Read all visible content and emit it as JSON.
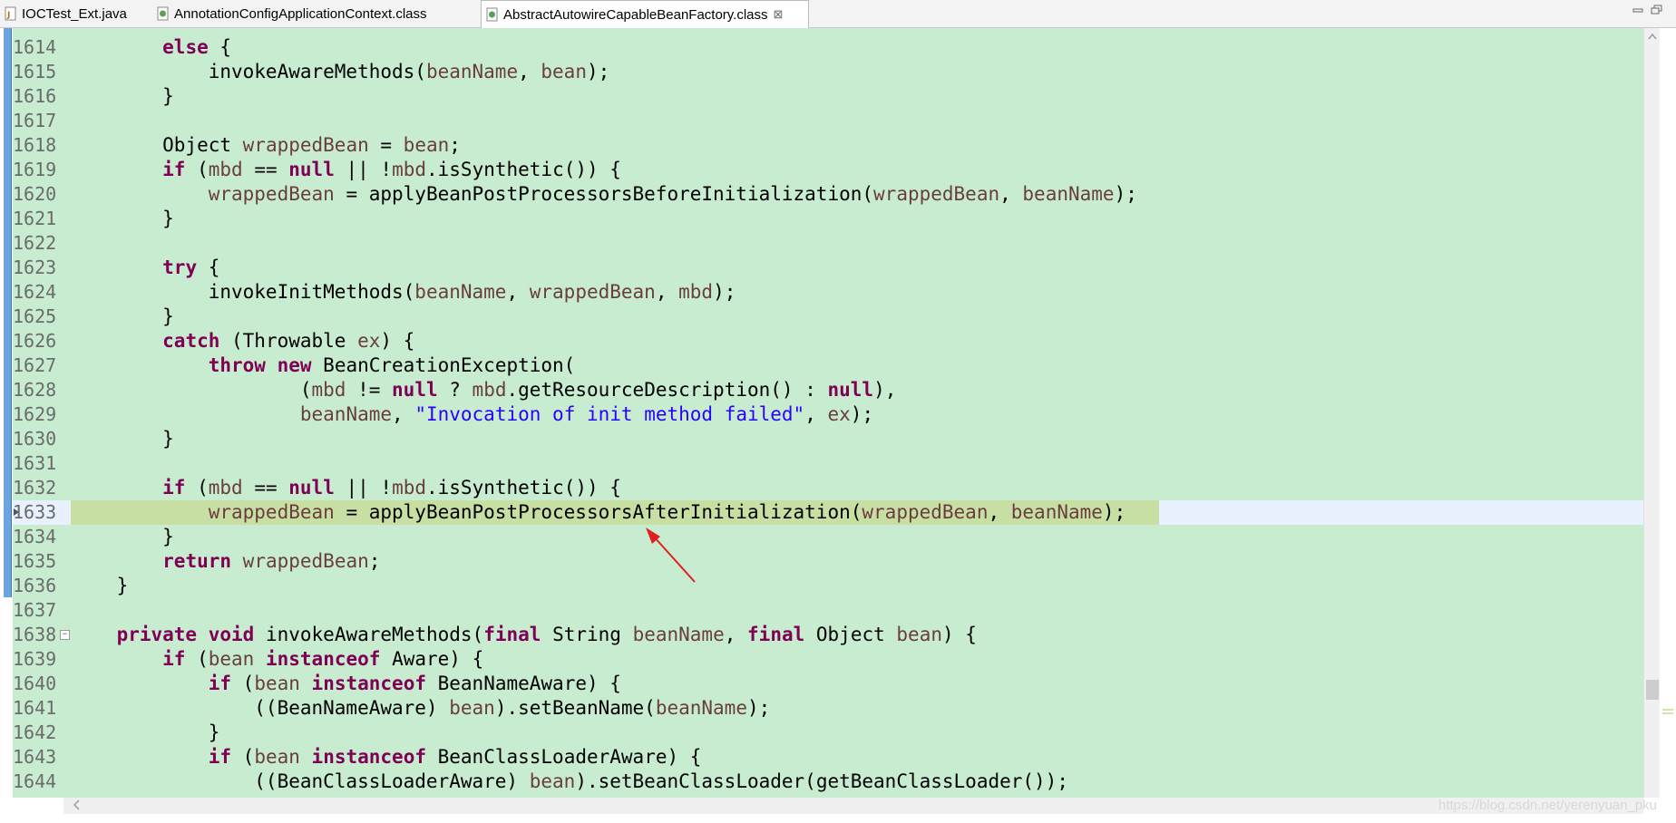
{
  "tabs": [
    {
      "label": "IOCTest_Ext.java",
      "icon": "java-file-icon",
      "active": false
    },
    {
      "label": "AnnotationConfigApplicationContext.class",
      "icon": "class-file-icon",
      "active": false
    },
    {
      "label": "AbstractAutowireCapableBeanFactory.class",
      "icon": "class-file-icon",
      "active": true,
      "close": "⊠"
    }
  ],
  "colors": {
    "editor_bg": "#c7ecd0",
    "keyword": "#7f0055",
    "variable": "#6a3e3e",
    "string": "#2a00ff",
    "current_line": "#e8f2fe",
    "annotation_arrow": "#e02020"
  },
  "editor": {
    "current_line": "1633",
    "lines": [
      {
        "n": "1614",
        "t": [
          [
            "",
            "        "
          ],
          [
            "kw",
            "else"
          ],
          [
            "",
            " {"
          ]
        ]
      },
      {
        "n": "1615",
        "t": [
          [
            "",
            "            invokeAwareMethods("
          ],
          [
            "var",
            "beanName"
          ],
          [
            "",
            ", "
          ],
          [
            "var",
            "bean"
          ],
          [
            "",
            ");"
          ]
        ]
      },
      {
        "n": "1616",
        "t": [
          [
            "",
            "        }"
          ]
        ]
      },
      {
        "n": "1617",
        "t": [
          [
            "",
            ""
          ]
        ]
      },
      {
        "n": "1618",
        "t": [
          [
            "",
            "        Object "
          ],
          [
            "var",
            "wrappedBean"
          ],
          [
            "",
            " = "
          ],
          [
            "var",
            "bean"
          ],
          [
            "",
            ";"
          ]
        ]
      },
      {
        "n": "1619",
        "t": [
          [
            "",
            "        "
          ],
          [
            "kw",
            "if"
          ],
          [
            "",
            " ("
          ],
          [
            "var",
            "mbd"
          ],
          [
            "",
            " == "
          ],
          [
            "kw",
            "null"
          ],
          [
            "",
            " || !"
          ],
          [
            "var",
            "mbd"
          ],
          [
            "",
            ".isSynthetic()) {"
          ]
        ]
      },
      {
        "n": "1620",
        "t": [
          [
            "",
            "            "
          ],
          [
            "var",
            "wrappedBean"
          ],
          [
            "",
            " = applyBeanPostProcessorsBeforeInitialization("
          ],
          [
            "var",
            "wrappedBean"
          ],
          [
            "",
            ", "
          ],
          [
            "var",
            "beanName"
          ],
          [
            "",
            ");"
          ]
        ]
      },
      {
        "n": "1621",
        "t": [
          [
            "",
            "        }"
          ]
        ]
      },
      {
        "n": "1622",
        "t": [
          [
            "",
            ""
          ]
        ]
      },
      {
        "n": "1623",
        "t": [
          [
            "",
            "        "
          ],
          [
            "kw",
            "try"
          ],
          [
            "",
            " {"
          ]
        ]
      },
      {
        "n": "1624",
        "t": [
          [
            "",
            "            invokeInitMethods("
          ],
          [
            "var",
            "beanName"
          ],
          [
            "",
            ", "
          ],
          [
            "var",
            "wrappedBean"
          ],
          [
            "",
            ", "
          ],
          [
            "var",
            "mbd"
          ],
          [
            "",
            ");"
          ]
        ]
      },
      {
        "n": "1625",
        "t": [
          [
            "",
            "        }"
          ]
        ]
      },
      {
        "n": "1626",
        "t": [
          [
            "",
            "        "
          ],
          [
            "kw",
            "catch"
          ],
          [
            "",
            " (Throwable "
          ],
          [
            "var",
            "ex"
          ],
          [
            "",
            ") {"
          ]
        ]
      },
      {
        "n": "1627",
        "t": [
          [
            "",
            "            "
          ],
          [
            "kw",
            "throw"
          ],
          [
            "",
            " "
          ],
          [
            "kw",
            "new"
          ],
          [
            "",
            " BeanCreationException("
          ]
        ]
      },
      {
        "n": "1628",
        "t": [
          [
            "",
            "                    ("
          ],
          [
            "var",
            "mbd"
          ],
          [
            "",
            " != "
          ],
          [
            "kw",
            "null"
          ],
          [
            "",
            " ? "
          ],
          [
            "var",
            "mbd"
          ],
          [
            "",
            ".getResourceDescription() : "
          ],
          [
            "kw",
            "null"
          ],
          [
            "",
            "),"
          ]
        ]
      },
      {
        "n": "1629",
        "t": [
          [
            "",
            "                    "
          ],
          [
            "var",
            "beanName"
          ],
          [
            "",
            ", "
          ],
          [
            "str",
            "\"Invocation of init method failed\""
          ],
          [
            "",
            ", "
          ],
          [
            "var",
            "ex"
          ],
          [
            "",
            ");"
          ]
        ]
      },
      {
        "n": "1630",
        "t": [
          [
            "",
            "        }"
          ]
        ]
      },
      {
        "n": "1631",
        "t": [
          [
            "",
            ""
          ]
        ]
      },
      {
        "n": "1632",
        "t": [
          [
            "",
            "        "
          ],
          [
            "kw",
            "if"
          ],
          [
            "",
            " ("
          ],
          [
            "var",
            "mbd"
          ],
          [
            "",
            " == "
          ],
          [
            "kw",
            "null"
          ],
          [
            "",
            " || !"
          ],
          [
            "var",
            "mbd"
          ],
          [
            "",
            ".isSynthetic()) {"
          ]
        ]
      },
      {
        "n": "1633",
        "t": [
          [
            "",
            "            "
          ],
          [
            "var",
            "wrappedBean"
          ],
          [
            "",
            " = applyBeanPostProcessorsAfterInitialization("
          ],
          [
            "var",
            "wrappedBean"
          ],
          [
            "",
            ", "
          ],
          [
            "var",
            "beanName"
          ],
          [
            "",
            ");"
          ]
        ]
      },
      {
        "n": "1634",
        "t": [
          [
            "",
            "        }"
          ]
        ]
      },
      {
        "n": "1635",
        "t": [
          [
            "",
            "        "
          ],
          [
            "kw",
            "return"
          ],
          [
            "",
            " "
          ],
          [
            "var",
            "wrappedBean"
          ],
          [
            "",
            ";"
          ]
        ]
      },
      {
        "n": "1636",
        "t": [
          [
            "",
            "    }"
          ]
        ]
      },
      {
        "n": "1637",
        "t": [
          [
            "",
            ""
          ]
        ]
      },
      {
        "n": "1638",
        "t": [
          [
            "",
            "    "
          ],
          [
            "kw",
            "private"
          ],
          [
            "",
            " "
          ],
          [
            "kw",
            "void"
          ],
          [
            "",
            " invokeAwareMethods("
          ],
          [
            "kw",
            "final"
          ],
          [
            "",
            " String "
          ],
          [
            "var",
            "beanName"
          ],
          [
            "",
            ", "
          ],
          [
            "kw",
            "final"
          ],
          [
            "",
            " Object "
          ],
          [
            "var",
            "bean"
          ],
          [
            "",
            ") {"
          ]
        ]
      },
      {
        "n": "1639",
        "t": [
          [
            "",
            "        "
          ],
          [
            "kw",
            "if"
          ],
          [
            "",
            " ("
          ],
          [
            "var",
            "bean"
          ],
          [
            "",
            " "
          ],
          [
            "kw",
            "instanceof"
          ],
          [
            "",
            " Aware) {"
          ]
        ]
      },
      {
        "n": "1640",
        "t": [
          [
            "",
            "            "
          ],
          [
            "kw",
            "if"
          ],
          [
            "",
            " ("
          ],
          [
            "var",
            "bean"
          ],
          [
            "",
            " "
          ],
          [
            "kw",
            "instanceof"
          ],
          [
            "",
            " BeanNameAware) {"
          ]
        ]
      },
      {
        "n": "1641",
        "t": [
          [
            "",
            "                ((BeanNameAware) "
          ],
          [
            "var",
            "bean"
          ],
          [
            "",
            ").setBeanName("
          ],
          [
            "var",
            "beanName"
          ],
          [
            "",
            ");"
          ]
        ]
      },
      {
        "n": "1642",
        "t": [
          [
            "",
            "            }"
          ]
        ]
      },
      {
        "n": "1643",
        "t": [
          [
            "",
            "            "
          ],
          [
            "kw",
            "if"
          ],
          [
            "",
            " ("
          ],
          [
            "var",
            "bean"
          ],
          [
            "",
            " "
          ],
          [
            "kw",
            "instanceof"
          ],
          [
            "",
            " BeanClassLoaderAware) {"
          ]
        ]
      },
      {
        "n": "1644",
        "t": [
          [
            "",
            "                ((BeanClassLoaderAware) "
          ],
          [
            "var",
            "bean"
          ],
          [
            "",
            ").setBeanClassLoader(getBeanClassLoader());"
          ]
        ]
      }
    ]
  },
  "watermark": "https://blog.csdn.net/yerenyuan_pku",
  "scroll": {
    "vertical_position": 0.87
  }
}
